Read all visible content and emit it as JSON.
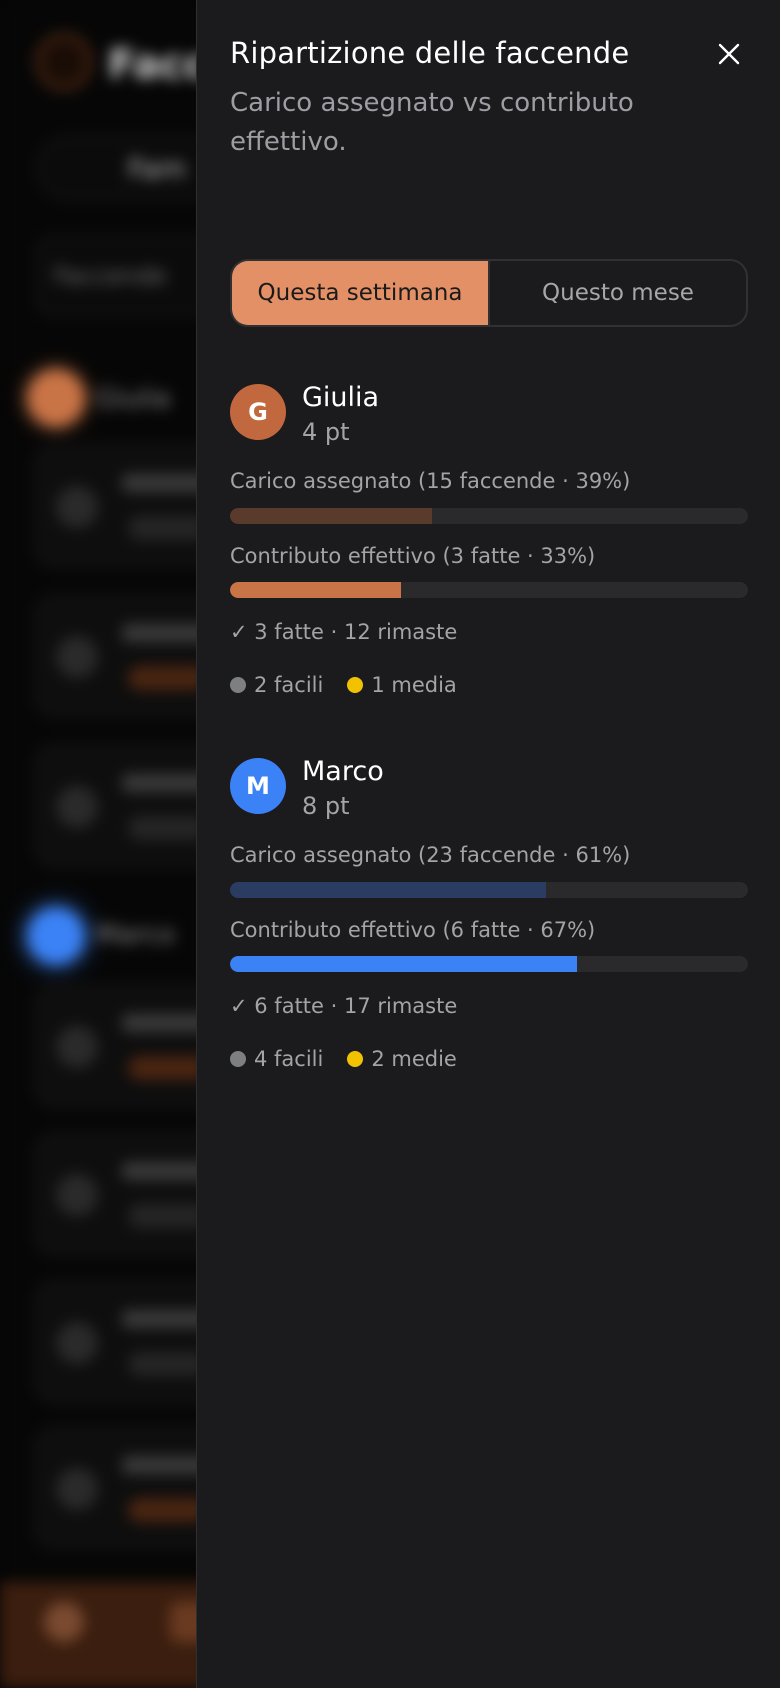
{
  "drawer": {
    "title": "Ripartizione delle faccende",
    "subtitle": "Carico assegnato vs contributo effettivo.",
    "close_icon": "close-icon"
  },
  "tabs": [
    {
      "label": "Questa settimana",
      "active": true
    },
    {
      "label": "Questo mese",
      "active": false
    }
  ],
  "people": [
    {
      "initial": "G",
      "name": "Giulia",
      "points": "4 pt",
      "avatar_color": "#c2683f",
      "assigned_label": "Carico assegnato (15 faccende · 39%)",
      "assigned_fraction": 0.39,
      "assigned_color": "#5a3a2a",
      "contribution_label": "Contributo effettivo (3 fatte · 33%)",
      "contribution_fraction": 0.33,
      "contribution_color": "#c97446",
      "summary": "✓ 3 fatte · 12 rimaste",
      "difficulties": [
        {
          "label": "2 facili",
          "color": "#7e8080"
        },
        {
          "label": "1 media",
          "color": "#f2c200"
        }
      ]
    },
    {
      "initial": "M",
      "name": "Marco",
      "points": "8 pt",
      "avatar_color": "#3b82f6",
      "assigned_label": "Carico assegnato (23 faccende · 61%)",
      "assigned_fraction": 0.61,
      "assigned_color": "#2b3c63",
      "contribution_label": "Contributo effettivo (6 fatte · 67%)",
      "contribution_fraction": 0.67,
      "contribution_color": "#3b82f6",
      "summary": "✓ 6 fatte · 17 rimaste",
      "difficulties": [
        {
          "label": "4 facili",
          "color": "#7e8080"
        },
        {
          "label": "2 medie",
          "color": "#f2c200"
        }
      ]
    }
  ]
}
